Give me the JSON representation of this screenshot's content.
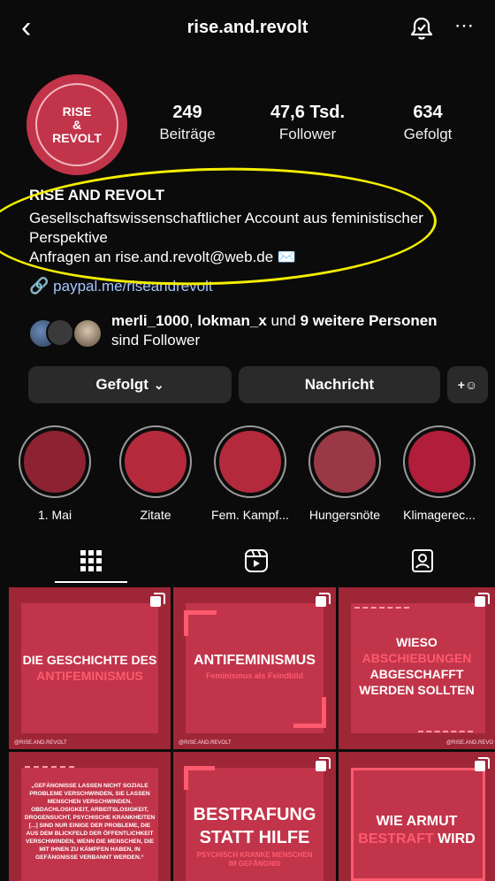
{
  "header": {
    "title": "rise.and.revolt"
  },
  "profile": {
    "avatar_text": [
      "RISE",
      "&",
      "REVOLT"
    ],
    "stats": [
      {
        "value": "249",
        "label": "Beiträge"
      },
      {
        "value": "47,6 Tsd.",
        "label": "Follower"
      },
      {
        "value": "634",
        "label": "Gefolgt"
      }
    ],
    "name": "RISE AND REVOLT",
    "bio_line1": "Gesellschaftswissenschaftlicher Account aus feministischer",
    "bio_line2": "Perspektive",
    "bio_line3": "Anfragen an rise.and.revolt@web.de ✉️",
    "link": "paypal.me/riseandrevolt"
  },
  "followers": {
    "user1": "merli_1000",
    "sep": ", ",
    "user2": "lokman_x",
    "mid": " und ",
    "others": "9 weitere Personen",
    "line2": "sind Follower"
  },
  "actions": {
    "follow_label": "Gefolgt",
    "message_label": "Nachricht"
  },
  "highlights": [
    {
      "label": "1. Mai",
      "color": "#8d2332"
    },
    {
      "label": "Zitate",
      "color": "#b42a3c"
    },
    {
      "label": "Fem. Kampf...",
      "color": "#b22a3b"
    },
    {
      "label": "Hungersnöte",
      "color": "#9a3845"
    },
    {
      "label": "Klimagerec...",
      "color": "#b01e3a"
    }
  ],
  "posts": [
    {
      "line1": "DIE GESCHICHTE DES",
      "line2": "ANTIFEMINISMUS",
      "footer": "@RISE.AND.REVOLT"
    },
    {
      "line1": "ANTIFEMINISMUS",
      "line2": "Feminismus als Feindbild",
      "footer": "@RISE.AND.REVOLT"
    },
    {
      "line1": "WIESO",
      "line2": "ABSCHIEBUNGEN",
      "line3": "ABGESCHAFFT",
      "line4": "WERDEN SOLLTEN",
      "footer": "@RISE.AND.REVO"
    },
    {
      "quote": "„GEFÄNGNISSE LASSEN NICHT SOZIALE PROBLEME VERSCHWINDEN, SIE LASSEN MENSCHEN VERSCHWINDEN. OBDACHLOSIGKEIT, ARBEITSLOSIGKEIT, DROGENSUCHT, PSYCHISCHE KRANKHEITEN [...] SIND NUR EINIGE DER PROBLEME, DIE AUS DEM BLICKFELD DER ÖFFENTLICHKEIT VERSCHWINDEN, WENN DIE MENSCHEN, DIE MIT IHNEN ZU KÄMPFEN HABEN, IN GEFÄNGNISSE VERBANNT WERDEN.“"
    },
    {
      "line1": "BESTRAFUNG",
      "line2": "STATT HILFE",
      "line3": "PSYCHISCH KRANKE MENSCHEN",
      "line4": "IM GEFÄNGNIS"
    },
    {
      "line1": "WIE ARMUT",
      "line2": "BESTRAFT",
      "line3": "WIRD"
    }
  ],
  "colors": {
    "accent": "#c2344a",
    "annotation": "#f4ee00",
    "link": "#a6c4ff"
  }
}
